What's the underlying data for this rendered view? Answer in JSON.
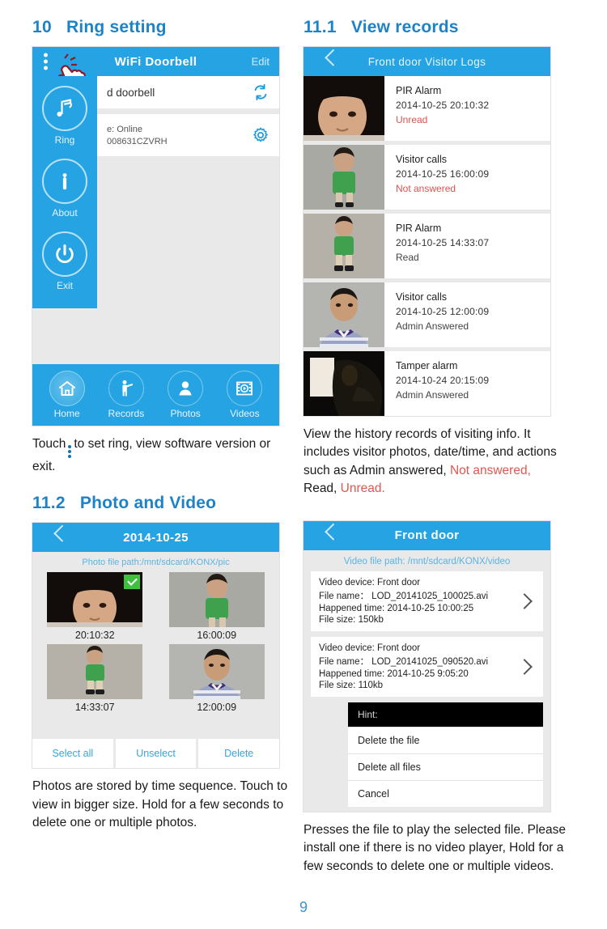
{
  "document": {
    "page_number": "9"
  },
  "section_ring": {
    "number": "10",
    "title": "Ring setting",
    "phone": {
      "header_title": "WiFi Doorbell",
      "header_edit": "Edit",
      "device_name": "d doorbell",
      "status_line": "e: Online",
      "serial_line": "008631CZVRH",
      "sidebar": [
        {
          "label": "Ring",
          "icon": "music-note-icon"
        },
        {
          "label": "About",
          "icon": "info-icon"
        },
        {
          "label": "Exit",
          "icon": "power-icon"
        }
      ],
      "tabs": [
        {
          "label": "Home",
          "icon": "home-icon",
          "active": true
        },
        {
          "label": "Records",
          "icon": "person-wave-icon",
          "active": false
        },
        {
          "label": "Photos",
          "icon": "portrait-icon",
          "active": false
        },
        {
          "label": "Videos",
          "icon": "film-play-icon",
          "active": false
        }
      ]
    },
    "caption_prefix": "Touch",
    "caption_suffix": "to set ring, view software version or exit."
  },
  "section_records": {
    "number": "11.1",
    "title": "View records",
    "phone": {
      "header_title": "Front door Visitor Logs",
      "back_icon": "back-chevron-icon",
      "entries": [
        {
          "event": "PIR Alarm",
          "datetime": "2014-10-25  20:10:32",
          "status": "Unread",
          "status_alert": true,
          "thumb": "infant-dark"
        },
        {
          "event": "Visitor calls",
          "datetime": "2014-10-25  16:00:09",
          "status": "Not answered",
          "status_alert": true,
          "thumb": "toddler-green"
        },
        {
          "event": "PIR  Alarm",
          "datetime": "2014-10-25  14:33:07",
          "status": "Read",
          "status_alert": false,
          "thumb": "toddler-walking"
        },
        {
          "event": "Visitor calls",
          "datetime": "2014-10-25  12:00:09",
          "status": "Admin Answered",
          "status_alert": false,
          "thumb": "man-striped"
        },
        {
          "event": "Tamper alarm",
          "datetime": "2014-10-24  20:15:09",
          "status": "Admin Answered",
          "status_alert": false,
          "thumb": "dark-figure"
        }
      ]
    },
    "caption_parts": [
      {
        "text": "View the history records of visiting info. It includes visitor photos, date/time, and actions such as Admin answered, ",
        "red": false
      },
      {
        "text": "Not answered,",
        "red": true
      },
      {
        "text": " Read, ",
        "red": false
      },
      {
        "text": "Unread.",
        "red": true
      }
    ]
  },
  "section_photo_video": {
    "number": "11.2",
    "title": "Photo and Video",
    "photo_phone": {
      "header_title": "2014-10-25",
      "file_path": "Photo file path:/mnt/sdcard/KONX/pic",
      "items": [
        {
          "time": "20:10:32",
          "selected": true,
          "thumb": "infant-dark"
        },
        {
          "time": "16:00:09",
          "selected": false,
          "thumb": "toddler-green"
        },
        {
          "time": "14:33:07",
          "selected": false,
          "thumb": "toddler-walking"
        },
        {
          "time": "12:00:09",
          "selected": false,
          "thumb": "man-striped"
        }
      ],
      "actions": [
        "Select all",
        "Unselect",
        "Delete"
      ]
    },
    "video_phone": {
      "header_title": "Front door",
      "file_path": "Video file path: /mnt/sdcard/KONX/video",
      "files": [
        {
          "device_label": "Video device:   Front door",
          "name_label": "File name：   LOD_20141025_100025.avi",
          "time_label": "Happened time:   2014-10-25 10:00:25",
          "size_label": "File size:   150kb"
        },
        {
          "device_label": "Video device:   Front door",
          "name_label": "File name：  LOD_20141025_090520.avi",
          "time_label": "Happened time: 2014-10-25 9:05:20",
          "size_label": "File size: 110kb"
        }
      ],
      "hint_menu": {
        "title": "Hint:",
        "items": [
          "Delete the file",
          "Delete all files",
          "Cancel"
        ]
      }
    },
    "caption_left": "Photos are stored by time sequence. Touch to view in bigger size. Hold for a few seconds to delete one or multiple photos.",
    "caption_right": "Presses the file to play the selected file. Please install one if there is no video player, Hold for a few seconds to delete one or multiple videos."
  },
  "colors": {
    "accent_blue": "#26a3e3",
    "heading_blue": "#1d83c6",
    "alert_red": "#d9534f",
    "panel_gray": "#e9e9e9"
  }
}
